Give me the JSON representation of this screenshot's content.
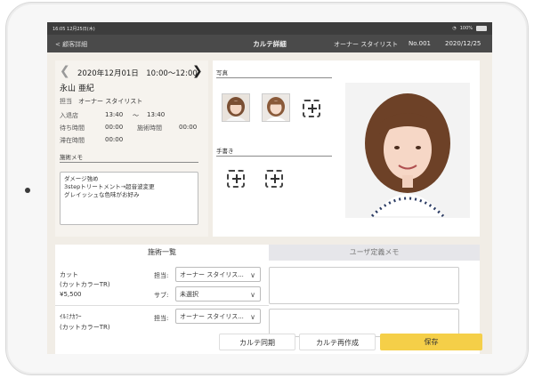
{
  "status": {
    "time": "16:05",
    "date": "12月25日(木)",
    "battery": "100%"
  },
  "nav": {
    "back_label": "< 顧客詳細",
    "title": "カルテ詳細",
    "staff": "オーナー スタイリスト",
    "number": "No.001",
    "date": "2020/12/25"
  },
  "visit": {
    "date_time": "2020年12月01日　10:00〜12:00",
    "customer_name": "永山 亜紀",
    "staff_label": "担当",
    "staff_value": "オーナー スタイリスト",
    "checkin_label": "入退店",
    "checkin_start": "13:40",
    "checkin_sep": "〜",
    "checkin_end": "13:40",
    "wait_label": "待ち時間",
    "wait_value": "00:00",
    "treatment_label": "施術時間",
    "treatment_value": "00:00",
    "stay_label": "滞在時間",
    "stay_value": "00:00",
    "memo_title": "施術メモ",
    "memo_lines": [
      "ダメージ強め",
      "3stepトリートメント→超音波変更",
      "グレイッシュな色味がお好み"
    ]
  },
  "photos": {
    "title": "写真",
    "handwriting_title": "手書き"
  },
  "tabs": {
    "services": "施術一覧",
    "user_memo": "ユーザ定義メモ"
  },
  "services": [
    {
      "name": "カット",
      "sub_name": "(カットカラーTR)",
      "price": "¥5,500",
      "staff_label": "担当:",
      "staff_value": "オーナー スタイリス...",
      "sub_label": "サブ:",
      "sub_value": "未選択"
    },
    {
      "name": "ｲﾙﾐﾅｶﾗｰ",
      "sub_name": "(カットカラーTR)",
      "staff_label": "担当:",
      "staff_value": "オーナー スタイリス..."
    }
  ],
  "buttons": {
    "sync": "カルテ同期",
    "recreate": "カルテ再作成",
    "save": "保存"
  },
  "colors": {
    "save": "#f5cf48",
    "navbar": "#4a4a4a",
    "panel": "#f1ede6"
  }
}
